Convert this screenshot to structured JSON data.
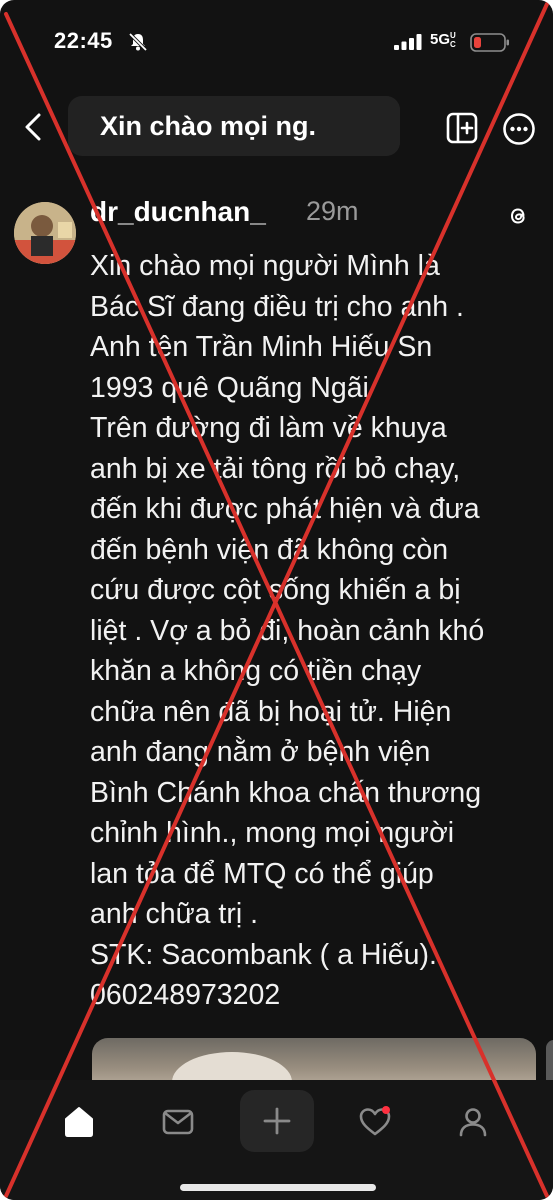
{
  "status_bar": {
    "time": "22:45",
    "network": "5G",
    "network_suffix": "UC"
  },
  "header": {
    "title": "Xin chào mọi ng."
  },
  "post": {
    "username": "dr_ducnhan_",
    "time": "29m",
    "lines": [
      "Xin chào mọi người Mình là",
      "Bác Sĩ đang điều trị cho anh .",
      "Anh tên Trần Minh Hiếu Sn",
      "1993 quê Quãng Ngãi",
      "Trên đường đi làm về khuya",
      "anh bị xe tải tông rồi bỏ chạy,",
      "đến khi được phát hiện và đưa",
      "đến bệnh viện đã không còn",
      "cứu được cột sống khiến a bị",
      "liệt . Vợ a bỏ đi, hoàn cảnh khó",
      "khăn a không có tiền chạy",
      "chữa nên đã bị hoại tử. Hiện",
      "anh đang nằm ở bệnh viện",
      "Bình Chánh khoa chấn thương",
      "chỉnh hình., mong mọi người",
      "lan tỏa để MTQ có thể giúp",
      "anh chữa trị .",
      "STK: Sacombank ( a Hiếu).",
      "060248973202"
    ]
  },
  "icons": {
    "back": "chevron-left-icon",
    "split": "split-view-icon",
    "more": "more-icon",
    "threads": "threads-icon",
    "bell": "bell-slash-icon",
    "tabs": [
      "home-icon",
      "inbox-icon",
      "plus-icon",
      "heart-icon",
      "person-icon"
    ]
  },
  "colors": {
    "background": "#121212",
    "overlay_cross": "#d8312b",
    "notification_dot": "#ff3040",
    "battery_low": "#e8433c"
  }
}
